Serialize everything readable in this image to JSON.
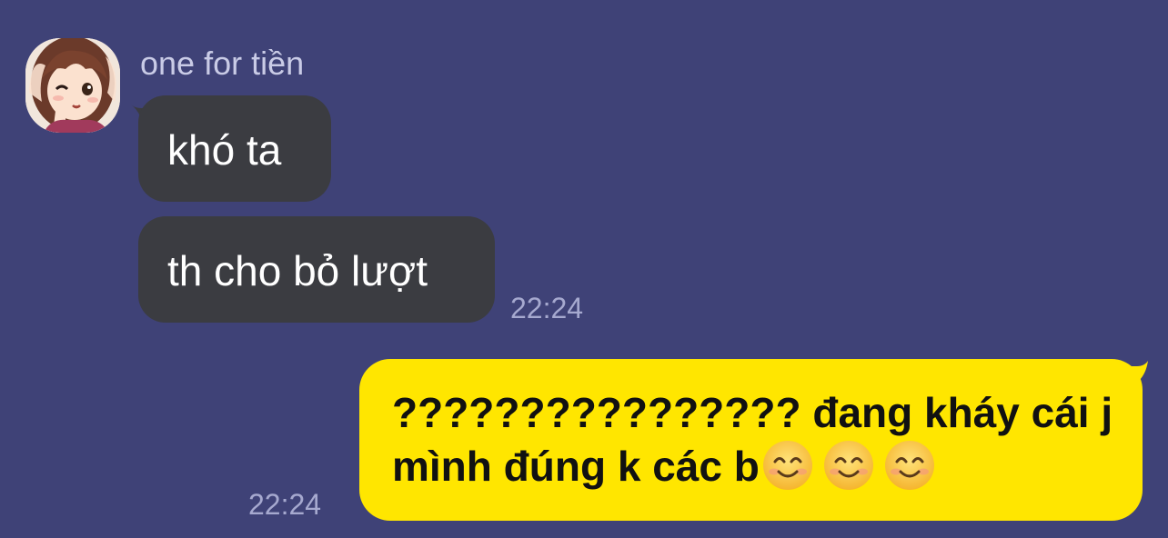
{
  "chat": {
    "incoming": {
      "sender_name": "one for tiền",
      "messages": [
        "khó ta",
        "th cho bỏ lượt"
      ],
      "time": "22:24"
    },
    "outgoing": {
      "line1": "???????????????? đang kháy cái j",
      "line2": "mình đúng k các b",
      "emoji": [
        "smiling-face-icon",
        "smiling-face-icon",
        "smiling-face-icon"
      ],
      "time": "22:24"
    }
  },
  "colors": {
    "background": "#3f4277",
    "incoming_bubble": "#3b3c41",
    "outgoing_bubble": "#ffe600",
    "timestamp": "#a6a9cf"
  }
}
